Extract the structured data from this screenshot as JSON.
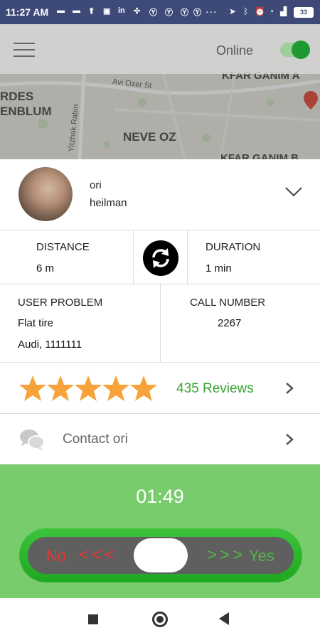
{
  "status_bar": {
    "time": "11:27 AM",
    "notification_icons": [
      "message-icon",
      "message-icon",
      "upload-icon",
      "image-icon",
      "linkedin-icon",
      "sync-icon",
      "yahoo-icon",
      "yahoo-icon",
      "yahoo-icon",
      "yahoo-icon"
    ],
    "more": "...",
    "battery": "33"
  },
  "app_bar": {
    "status_label": "Online",
    "online": true
  },
  "map": {
    "labels": [
      "RDES",
      "ENBLUM",
      "NEVE OZ",
      "KFAR GANIM A",
      "KFAR GANIM B"
    ],
    "streets": [
      "Avi Ozer St",
      "Yitzhak Rabin"
    ]
  },
  "customer": {
    "first_name": "ori",
    "last_name": "heilman"
  },
  "metrics": {
    "distance_label": "DISTANCE",
    "distance_value": "6 m",
    "duration_label": "DURATION",
    "duration_value": "1 min"
  },
  "request": {
    "problem_label": "USER PROBLEM",
    "problem_value": "Flat tire",
    "vehicle": "Audi, 1111111",
    "call_label": "CALL NUMBER",
    "call_value": "2267"
  },
  "reviews": {
    "stars": 5,
    "stars_max": 5,
    "text": "435 Reviews"
  },
  "contact": {
    "text": "Contact ori"
  },
  "accept": {
    "timer": "01:49",
    "no_label": "No",
    "no_arrows": "<<<",
    "yes_arrows": ">>>",
    "yes_label": "Yes"
  },
  "colors": {
    "status_bar": "#3d4a78",
    "accent_green": "#3aa536",
    "panel_green": "#78cc6c",
    "star_orange": "#f7a23a",
    "no_red": "#e8362e"
  }
}
